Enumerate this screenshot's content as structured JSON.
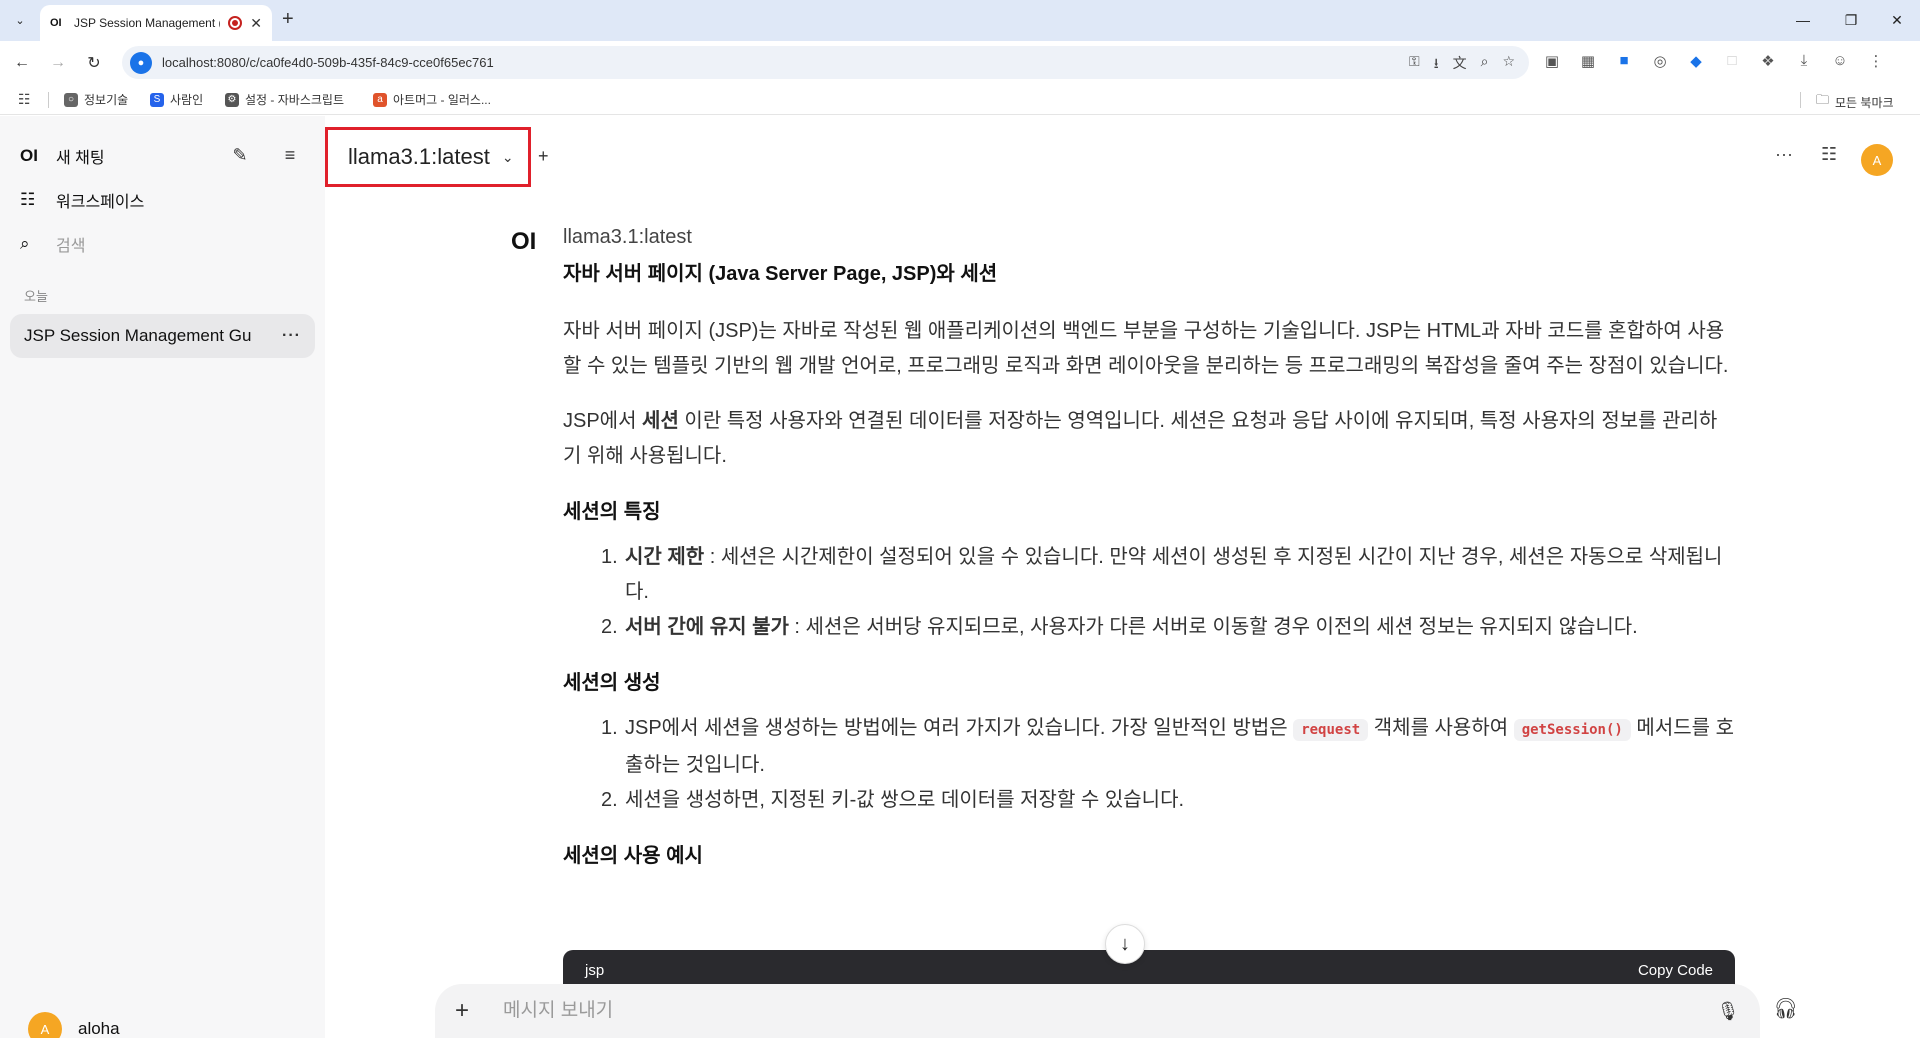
{
  "browser": {
    "tab_title": "JSP Session Management (",
    "tab_favicon": "OI",
    "url": "localhost:8080/c/ca0fe4d0-509b-435f-84c9-cce0f65ec761",
    "bookmarks": [
      "정보기술",
      "사람인",
      "설정 - 자바스크립트",
      "아트머그 - 일러스...",
      "모든 북마크"
    ]
  },
  "sidebar": {
    "logo": "OI",
    "new_chat": "새 채팅",
    "workspace": "워크스페이스",
    "search_placeholder": "검색",
    "today_label": "오늘",
    "chats": [
      {
        "title": "JSP Session Management Gu"
      }
    ],
    "user": {
      "initial": "A",
      "name": "aloha"
    }
  },
  "header": {
    "model": "llama3.1:latest",
    "avatar_initial": "A",
    "accent_color": "#f5a623",
    "highlight_color": "#e0202b"
  },
  "message": {
    "logo": "OI",
    "model": "llama3.1:latest",
    "title": "자바 서버 페이지 (Java Server Page, JSP)와 세션",
    "p1": "자바 서버 페이지 (JSP)는 자바로 작성된 웹 애플리케이션의 백엔드 부분을 구성하는 기술입니다. JSP는 HTML과 자바 코드를 혼합하여 사용할 수 있는 템플릿 기반의 웹 개발 언어로, 프로그래밍 로직과 화면 레이아웃을 분리하는 등 프로그래밍의 복잡성을 줄여 주는 장점이 있습니다.",
    "p2_pre": "JSP에서 ",
    "p2_bold": "세션",
    "p2_post": " 이란 특정 사용자와 연결된 데이터를 저장하는 영역입니다. 세션은 요청과 응답 사이에 유지되며, 특정 사용자의 정보를 관리하기 위해 사용됩니다.",
    "h_features": "세션의 특징",
    "features": [
      {
        "num": "1.",
        "bold": "시간 제한",
        "text": " : 세션은 시간제한이 설정되어 있을 수 있습니다. 만약 세션이 생성된 후 지정된 시간이 지난 경우, 세션은 자동으로 삭제됩니다."
      },
      {
        "num": "2.",
        "bold": "서버 간에 유지 불가",
        "text": " : 세션은 서버당 유지되므로, 사용자가 다른 서버로 이동할 경우 이전의 세션 정보는 유지되지 않습니다."
      }
    ],
    "h_creation": "세션의 생성",
    "creation": [
      {
        "num": "1.",
        "pre": "JSP에서 세션을 생성하는 방법에는 여러 가지가 있습니다. 가장 일반적인 방법은 ",
        "code1": "request",
        "mid": " 객체를 사용하여 ",
        "code2": "getSession()",
        "post": " 메서드를 호출하는 것입니다."
      },
      {
        "num": "2.",
        "text": "세션을 생성하면, 지정된 키-값 쌍으로 데이터를 저장할 수 있습니다."
      }
    ],
    "h_example": "세션의 사용 예시",
    "code_lang": "jsp",
    "copy_label": "Copy Code"
  },
  "input": {
    "placeholder": "메시지 보내기"
  }
}
